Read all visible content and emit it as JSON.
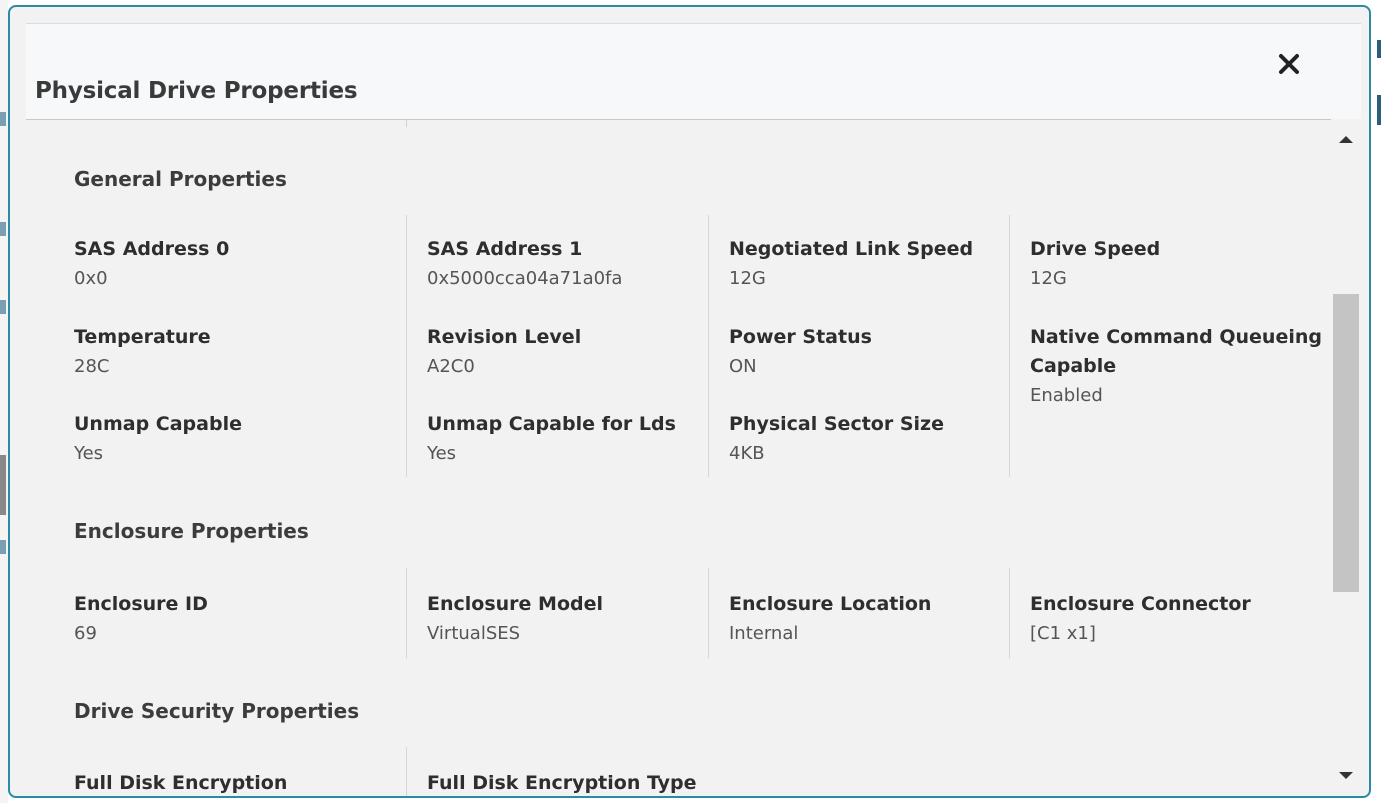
{
  "dialog": {
    "title": "Physical Drive Properties",
    "close_icon": "close-icon"
  },
  "sections": {
    "general": {
      "title": "General Properties",
      "props": [
        {
          "label": "SAS Address 0",
          "value": "0x0"
        },
        {
          "label": "SAS Address 1",
          "value": "0x5000cca04a71a0fa"
        },
        {
          "label": "Negotiated Link Speed",
          "value": "12G"
        },
        {
          "label": "Drive Speed",
          "value": "12G"
        },
        {
          "label": "Temperature",
          "value": "28C"
        },
        {
          "label": "Revision Level",
          "value": "A2C0"
        },
        {
          "label": "Power Status",
          "value": "ON"
        },
        {
          "label": "Native Command Queueing Capable",
          "value": "Enabled"
        },
        {
          "label": "Unmap Capable",
          "value": "Yes"
        },
        {
          "label": "Unmap Capable for Lds",
          "value": "Yes"
        },
        {
          "label": "Physical Sector Size",
          "value": "4KB"
        }
      ]
    },
    "enclosure": {
      "title": "Enclosure Properties",
      "props": [
        {
          "label": "Enclosure ID",
          "value": "69"
        },
        {
          "label": "Enclosure Model",
          "value": "VirtualSES"
        },
        {
          "label": "Enclosure Location",
          "value": "Internal"
        },
        {
          "label": "Enclosure Connector",
          "value": "[C1 x1]"
        }
      ]
    },
    "security": {
      "title": "Drive Security Properties",
      "props": [
        {
          "label": "Full Disk Encryption"
        },
        {
          "label": "Full Disk Encryption Type"
        }
      ]
    }
  },
  "scrollbar": {
    "up_icon": "scroll-up-arrow-icon",
    "down_icon": "scroll-down-arrow-icon",
    "position_fraction": 0.26
  },
  "colors": {
    "accent_border": "#2b8aa6",
    "background": "#f2f2f2",
    "label_text": "#2e2e2e",
    "value_text": "#555555"
  }
}
